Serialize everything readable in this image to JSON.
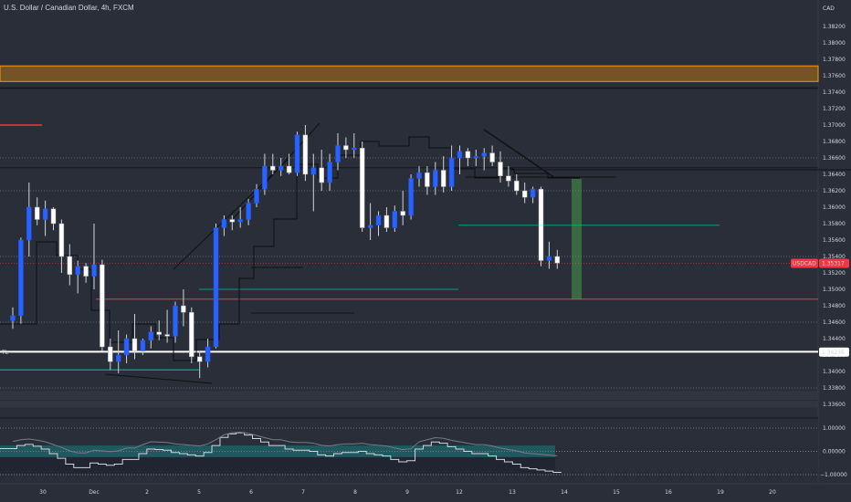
{
  "header": {
    "title": "U.S. Dollar / Canadian Dollar, 4h, FXCM"
  },
  "price_axis": {
    "currency": "CAD",
    "ticks": [
      "1.38200",
      "1.38000",
      "1.37800",
      "1.37600",
      "1.37400",
      "1.37200",
      "1.37000",
      "1.36800",
      "1.36600",
      "1.36400",
      "1.36200",
      "1.36000",
      "1.35800",
      "1.35600",
      "1.35400",
      "1.35200",
      "1.35000",
      "1.34800",
      "1.34600",
      "1.34400",
      "1.34200",
      "1.34000",
      "1.33800",
      "1.33600"
    ],
    "current_label": "USDCAD",
    "current_value": "1.35317",
    "line_value": "1.34236"
  },
  "indicator_axis": {
    "ticks": [
      "1.00000",
      "0.00000",
      "−1.00000"
    ]
  },
  "time_axis": {
    "labels": [
      "30",
      "Dec",
      "2",
      "5",
      "6",
      "7",
      "8",
      "9",
      "12",
      "13",
      "14",
      "15",
      "16",
      "19",
      "20"
    ]
  },
  "left_marker": "TL",
  "colors": {
    "background": "#2a2e39",
    "bull": "#2962ff",
    "bear": "#ffffff",
    "orange_zone": "#ff9800",
    "red_line": "#f23645",
    "teal": "#089981",
    "green_box": "#4caf50"
  },
  "chart_data": {
    "type": "candlestick",
    "title": "U.S. Dollar / Canadian Dollar, 4h, FXCM",
    "ylim": [
      1.3355,
      1.3835
    ],
    "candles": [
      {
        "o": 1.3462,
        "h": 1.3478,
        "l": 1.3452,
        "c": 1.3468
      },
      {
        "o": 1.3468,
        "h": 1.3563,
        "l": 1.3458,
        "c": 1.356
      },
      {
        "o": 1.356,
        "h": 1.363,
        "l": 1.354,
        "c": 1.36
      },
      {
        "o": 1.36,
        "h": 1.3612,
        "l": 1.3578,
        "c": 1.3585
      },
      {
        "o": 1.3585,
        "h": 1.3608,
        "l": 1.3565,
        "c": 1.3598
      },
      {
        "o": 1.3598,
        "h": 1.36,
        "l": 1.3572,
        "c": 1.358
      },
      {
        "o": 1.358,
        "h": 1.3585,
        "l": 1.352,
        "c": 1.354
      },
      {
        "o": 1.354,
        "h": 1.3555,
        "l": 1.3505,
        "c": 1.3518
      },
      {
        "o": 1.3518,
        "h": 1.3535,
        "l": 1.3495,
        "c": 1.3528
      },
      {
        "o": 1.3528,
        "h": 1.3532,
        "l": 1.3508,
        "c": 1.3516
      },
      {
        "o": 1.3516,
        "h": 1.358,
        "l": 1.35,
        "c": 1.353
      },
      {
        "o": 1.353,
        "h": 1.3536,
        "l": 1.3425,
        "c": 1.343
      },
      {
        "o": 1.343,
        "h": 1.344,
        "l": 1.3402,
        "c": 1.3412
      },
      {
        "o": 1.3412,
        "h": 1.345,
        "l": 1.3398,
        "c": 1.342
      },
      {
        "o": 1.342,
        "h": 1.3445,
        "l": 1.341,
        "c": 1.344
      },
      {
        "o": 1.344,
        "h": 1.347,
        "l": 1.3415,
        "c": 1.3425
      },
      {
        "o": 1.3425,
        "h": 1.344,
        "l": 1.342,
        "c": 1.3438
      },
      {
        "o": 1.3438,
        "h": 1.3455,
        "l": 1.3428,
        "c": 1.3448
      },
      {
        "o": 1.3448,
        "h": 1.3462,
        "l": 1.3438,
        "c": 1.3445
      },
      {
        "o": 1.3445,
        "h": 1.3475,
        "l": 1.3435,
        "c": 1.3443
      },
      {
        "o": 1.3443,
        "h": 1.3485,
        "l": 1.3435,
        "c": 1.348
      },
      {
        "o": 1.348,
        "h": 1.35,
        "l": 1.3455,
        "c": 1.3472
      },
      {
        "o": 1.3472,
        "h": 1.3478,
        "l": 1.341,
        "c": 1.3418
      },
      {
        "o": 1.3418,
        "h": 1.3425,
        "l": 1.3392,
        "c": 1.3412
      },
      {
        "o": 1.3412,
        "h": 1.344,
        "l": 1.3405,
        "c": 1.343
      },
      {
        "o": 1.343,
        "h": 1.358,
        "l": 1.3428,
        "c": 1.3575
      },
      {
        "o": 1.3575,
        "h": 1.359,
        "l": 1.3565,
        "c": 1.3585
      },
      {
        "o": 1.3585,
        "h": 1.359,
        "l": 1.3572,
        "c": 1.3582
      },
      {
        "o": 1.3582,
        "h": 1.36,
        "l": 1.3575,
        "c": 1.3585
      },
      {
        "o": 1.3585,
        "h": 1.361,
        "l": 1.3578,
        "c": 1.3605
      },
      {
        "o": 1.3605,
        "h": 1.3628,
        "l": 1.36,
        "c": 1.3622
      },
      {
        "o": 1.3622,
        "h": 1.3665,
        "l": 1.3615,
        "c": 1.365
      },
      {
        "o": 1.365,
        "h": 1.3665,
        "l": 1.364,
        "c": 1.3645
      },
      {
        "o": 1.3645,
        "h": 1.366,
        "l": 1.3638,
        "c": 1.365
      },
      {
        "o": 1.365,
        "h": 1.3665,
        "l": 1.364,
        "c": 1.3642
      },
      {
        "o": 1.3642,
        "h": 1.3692,
        "l": 1.3638,
        "c": 1.3688
      },
      {
        "o": 1.3688,
        "h": 1.37,
        "l": 1.3632,
        "c": 1.364
      },
      {
        "o": 1.364,
        "h": 1.3665,
        "l": 1.3595,
        "c": 1.3648
      },
      {
        "o": 1.3648,
        "h": 1.367,
        "l": 1.362,
        "c": 1.363
      },
      {
        "o": 1.363,
        "h": 1.3665,
        "l": 1.362,
        "c": 1.3655
      },
      {
        "o": 1.3655,
        "h": 1.369,
        "l": 1.3645,
        "c": 1.3675
      },
      {
        "o": 1.3675,
        "h": 1.3685,
        "l": 1.366,
        "c": 1.367
      },
      {
        "o": 1.367,
        "h": 1.369,
        "l": 1.366,
        "c": 1.3672
      },
      {
        "o": 1.3672,
        "h": 1.368,
        "l": 1.357,
        "c": 1.3575
      },
      {
        "o": 1.3575,
        "h": 1.3605,
        "l": 1.356,
        "c": 1.3578
      },
      {
        "o": 1.3578,
        "h": 1.3595,
        "l": 1.3565,
        "c": 1.359
      },
      {
        "o": 1.359,
        "h": 1.36,
        "l": 1.357,
        "c": 1.3575
      },
      {
        "o": 1.3575,
        "h": 1.3602,
        "l": 1.357,
        "c": 1.3595
      },
      {
        "o": 1.3595,
        "h": 1.362,
        "l": 1.3578,
        "c": 1.359
      },
      {
        "o": 1.359,
        "h": 1.364,
        "l": 1.3585,
        "c": 1.3635
      },
      {
        "o": 1.3635,
        "h": 1.365,
        "l": 1.3625,
        "c": 1.3642
      },
      {
        "o": 1.3642,
        "h": 1.365,
        "l": 1.3615,
        "c": 1.3625
      },
      {
        "o": 1.3625,
        "h": 1.3655,
        "l": 1.3615,
        "c": 1.3645
      },
      {
        "o": 1.3645,
        "h": 1.3662,
        "l": 1.3618,
        "c": 1.3625
      },
      {
        "o": 1.3625,
        "h": 1.3675,
        "l": 1.362,
        "c": 1.366
      },
      {
        "o": 1.366,
        "h": 1.3675,
        "l": 1.364,
        "c": 1.3668
      },
      {
        "o": 1.3668,
        "h": 1.3672,
        "l": 1.365,
        "c": 1.366
      },
      {
        "o": 1.366,
        "h": 1.367,
        "l": 1.365,
        "c": 1.3662
      },
      {
        "o": 1.3662,
        "h": 1.3672,
        "l": 1.3645,
        "c": 1.3666
      },
      {
        "o": 1.3666,
        "h": 1.3675,
        "l": 1.365,
        "c": 1.3655
      },
      {
        "o": 1.3655,
        "h": 1.3668,
        "l": 1.363,
        "c": 1.3638
      },
      {
        "o": 1.3638,
        "h": 1.365,
        "l": 1.3625,
        "c": 1.3632
      },
      {
        "o": 1.3632,
        "h": 1.364,
        "l": 1.3615,
        "c": 1.362
      },
      {
        "o": 1.362,
        "h": 1.363,
        "l": 1.3605,
        "c": 1.3612
      },
      {
        "o": 1.3612,
        "h": 1.3625,
        "l": 1.3605,
        "c": 1.3622
      },
      {
        "o": 1.3622,
        "h": 1.3625,
        "l": 1.3528,
        "c": 1.3535
      },
      {
        "o": 1.3535,
        "h": 1.3558,
        "l": 1.3525,
        "c": 1.354
      },
      {
        "o": 1.354,
        "h": 1.3548,
        "l": 1.3525,
        "c": 1.3532
      }
    ],
    "horizontal_levels": [
      {
        "name": "orange-zone",
        "from": 1.3753,
        "to": 1.3772
      },
      {
        "name": "black-line-1",
        "price": 1.3745
      },
      {
        "name": "red-line-upper",
        "price": 1.37
      },
      {
        "name": "black-line-2",
        "price": 1.3648
      },
      {
        "name": "teal-line-upper",
        "price": 1.3578
      },
      {
        "name": "teal-line-lower",
        "price": 1.35
      },
      {
        "name": "red-line-lower",
        "price": 1.3488
      },
      {
        "name": "white-line",
        "price": 1.3424
      },
      {
        "name": "teal-line-left",
        "price": 1.3402
      },
      {
        "name": "black-line-lower",
        "price": 1.3365
      }
    ],
    "oscillator": {
      "ylim": [
        -1.3,
        1.3
      ],
      "values": [
        0.12,
        0.25,
        0.3,
        0.22,
        0.1,
        -0.1,
        -0.3,
        -0.55,
        -0.7,
        -0.7,
        -0.5,
        -0.55,
        -0.6,
        -0.55,
        -0.35,
        -0.35,
        -0.1,
        0.1,
        0.08,
        0.05,
        -0.05,
        -0.1,
        -0.15,
        -0.2,
        -0.05,
        0.25,
        0.6,
        0.75,
        0.8,
        0.7,
        0.55,
        0.4,
        0.25,
        0.25,
        0.1,
        0.05,
        0.05,
        0.0,
        -0.15,
        -0.2,
        -0.1,
        -0.05,
        -0.05,
        0.0,
        -0.1,
        -0.15,
        -0.2,
        -0.35,
        -0.45,
        -0.4,
        0.1,
        0.25,
        0.4,
        0.35,
        0.2,
        0.1,
        0.0,
        -0.1,
        -0.1,
        -0.2,
        -0.35,
        -0.45,
        -0.55,
        -0.7,
        -0.75,
        -0.8,
        -0.85,
        -0.9
      ]
    }
  }
}
